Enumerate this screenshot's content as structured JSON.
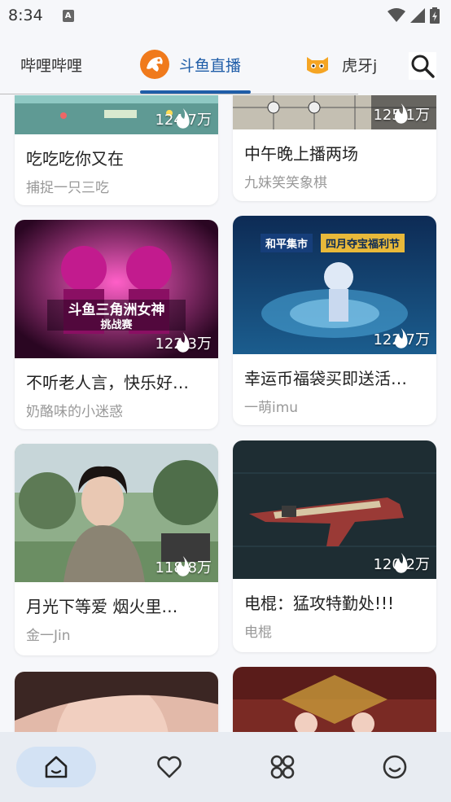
{
  "status_bar": {
    "time": "8:34",
    "notification_glyph": "A"
  },
  "top_nav": {
    "tabs": [
      {
        "label": "哔哩哔哩"
      },
      {
        "label": "斗鱼直播",
        "active": true
      },
      {
        "label": "虎牙j"
      }
    ]
  },
  "cards": [
    {
      "title": "吃吃吃你又在",
      "streamer": "捕捉一只三吃",
      "heat": "124.7万"
    },
    {
      "title": "中午晚上播两场",
      "streamer": "九妹笑笑象棋",
      "heat": "125.1万"
    },
    {
      "title": "不听老人言，快乐好…",
      "streamer": "奶酪味的小迷惑",
      "heat": "122.3万",
      "thumb_text": [
        "斗鱼三角洲女神",
        "挑战赛"
      ]
    },
    {
      "title": "幸运币福袋买即送活…",
      "streamer": "一萌imu",
      "heat": "122.7万",
      "thumb_text": [
        "和平集市",
        "四月夺宝福利节"
      ]
    },
    {
      "title": "月光下等爱  烟火里…",
      "streamer": "金一Jin",
      "heat": "118.8万"
    },
    {
      "title": "电棍：猛攻特勤处!!!",
      "streamer": "电棍",
      "heat": "120.2万"
    },
    {
      "title": "",
      "streamer": "",
      "heat": ""
    },
    {
      "title": "",
      "streamer": "",
      "heat": ""
    }
  ],
  "bottom_nav": [
    {
      "icon": "home-icon",
      "active": true
    },
    {
      "icon": "heart-icon"
    },
    {
      "icon": "apps-icon"
    },
    {
      "icon": "smiley-icon"
    }
  ],
  "colors": {
    "accent": "#1f5da8",
    "bottom_bar": "#e8ecf2",
    "active_pill": "#d3e2f4",
    "douyu_orange": "#f07a1c"
  }
}
